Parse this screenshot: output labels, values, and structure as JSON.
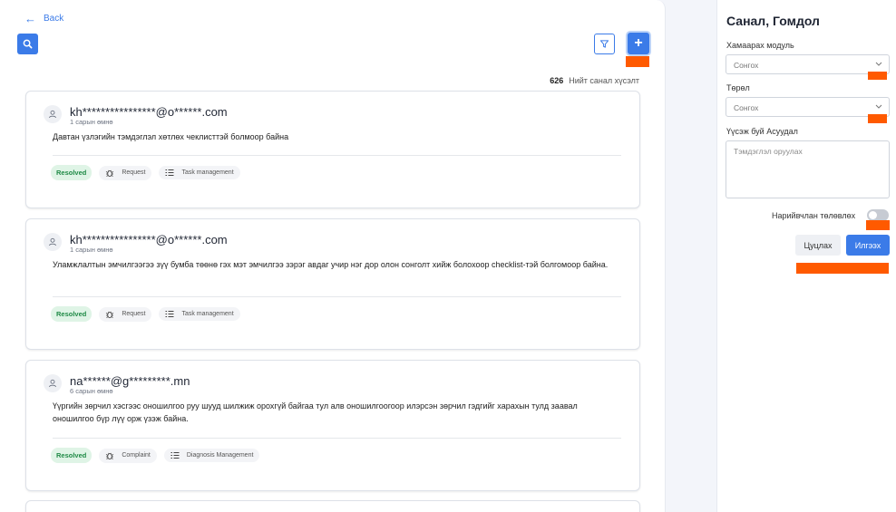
{
  "header": {
    "back_label": "Back",
    "add_label": "+"
  },
  "summary": {
    "count": "626",
    "count_label": "Нийт санал хүсэлт"
  },
  "cards": [
    {
      "email": "kh****************@o******.com",
      "time": "1 сарын өмнө",
      "description": "Давтан үзлэгийн тэмдэглэл хөтлөх чеклисттэй болмоор байна",
      "status": "Resolved",
      "type": "Request",
      "module": "Task management"
    },
    {
      "email": "kh****************@o******.com",
      "time": "1 сарын өмнө",
      "description": "Уламжлалтын эмчилгээгээ зүү бумба төөнө гэх мэт эмчилгээ зэрэг авдаг учир нэг дор олон сонголт хийж болохоор checklist-тэй болгомоор байна.",
      "status": "Resolved",
      "type": "Request",
      "module": "Task management"
    },
    {
      "email": "na******@g*********.mn",
      "time": "6 сарын өмнө",
      "description": "Үүргийн зөрчил хэсгээс оношилгоо руу шууд шилжиж орохгүй байгаа тул алв оношилгоогоор илэрсэн зөрчил гэдгийг харахын тулд заавал оношилгоо бүр лүү орж үзэж байна.",
      "status": "Resolved",
      "type": "Complaint",
      "module": "Diagnosis Management"
    }
  ],
  "side": {
    "title": "Санал, Гомдол",
    "module_label": "Хамаарах модуль",
    "module_placeholder": "Сонгох",
    "type_label": "Төрөл",
    "type_placeholder": "Сонгох",
    "text_label": "Үүсэж буй Асуудал",
    "text_placeholder": "Тэмдэглэл оруулах",
    "toggle_label": "Нарийвчлан төлөвлөх",
    "cancel_label": "Цуцлах",
    "send_label": "Илгээх"
  },
  "colors": {
    "accent": "#3b7be8",
    "marker": "#ff5a00",
    "resolved_bg": "#dff4e6",
    "resolved_text": "#1f8a46"
  }
}
